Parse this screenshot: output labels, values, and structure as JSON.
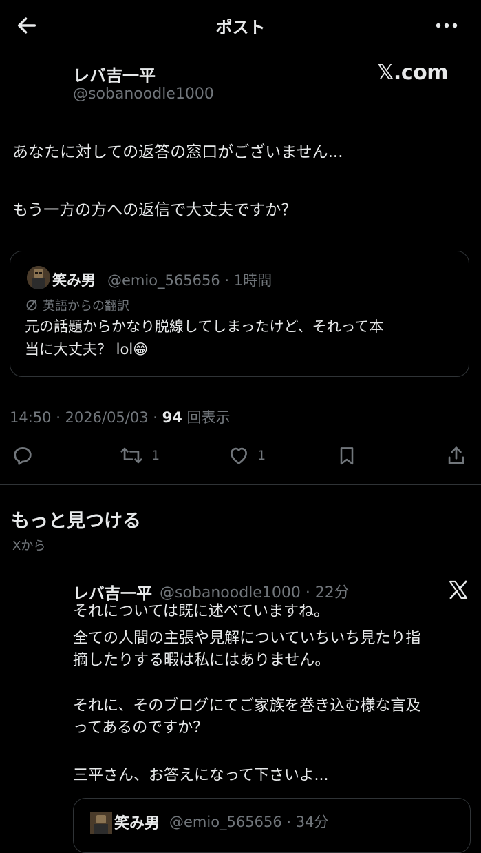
{
  "header": {
    "title": "ポスト",
    "back_icon": "arrow-left-icon",
    "more_icon": "more-horizontal-icon"
  },
  "post": {
    "display_name": "レバ吉一平",
    "handle": "@sobanoodle1000",
    "watermark": "𝕏.com",
    "body_lines": [
      "あなたに対しての返答の窓口がございません...",
      "もう一方の方への返信で大丈夫ですか？"
    ],
    "quote": {
      "name": "笑み男",
      "meta": "@emio_565656 · 1時間",
      "translation_label": "英語からの翻訳",
      "text_lines": [
        "元の話題からかなり脱線してしまったけど、それって本",
        "当に大丈夫？ lol😁"
      ]
    },
    "timestamp": "14:50 · 2026/05/03 · ",
    "views_count": "94",
    "views_label": " 回表示",
    "actions": {
      "reply_icon": "reply-icon",
      "repost_icon": "repost-icon",
      "repost_count": "1",
      "like_icon": "heart-icon",
      "like_count": "1",
      "bookmark_icon": "bookmark-icon",
      "share_icon": "share-icon"
    }
  },
  "discover": {
    "title": "もっと見つける",
    "subtitle": "Xから",
    "post": {
      "display_name": "レバ吉一平",
      "meta": "@sobanoodle1000 · 22分",
      "lines": [
        "それについては既に述べていますね。",
        "全ての人間の主張や見解についていちいち見たり指",
        "摘したりする暇は私にはありません。",
        "",
        "それに、そのブログにてご家族を巻き込む様な言及",
        "ってあるのですか？",
        "",
        "三平さん、お答えになって下さいよ..."
      ],
      "quote": {
        "name": "笑み男",
        "meta": "@emio_565656 · 34分"
      }
    }
  },
  "colors": {
    "background": "#000000",
    "text": "#e7e9ea",
    "muted": "#71767b",
    "border": "#2f3336"
  }
}
